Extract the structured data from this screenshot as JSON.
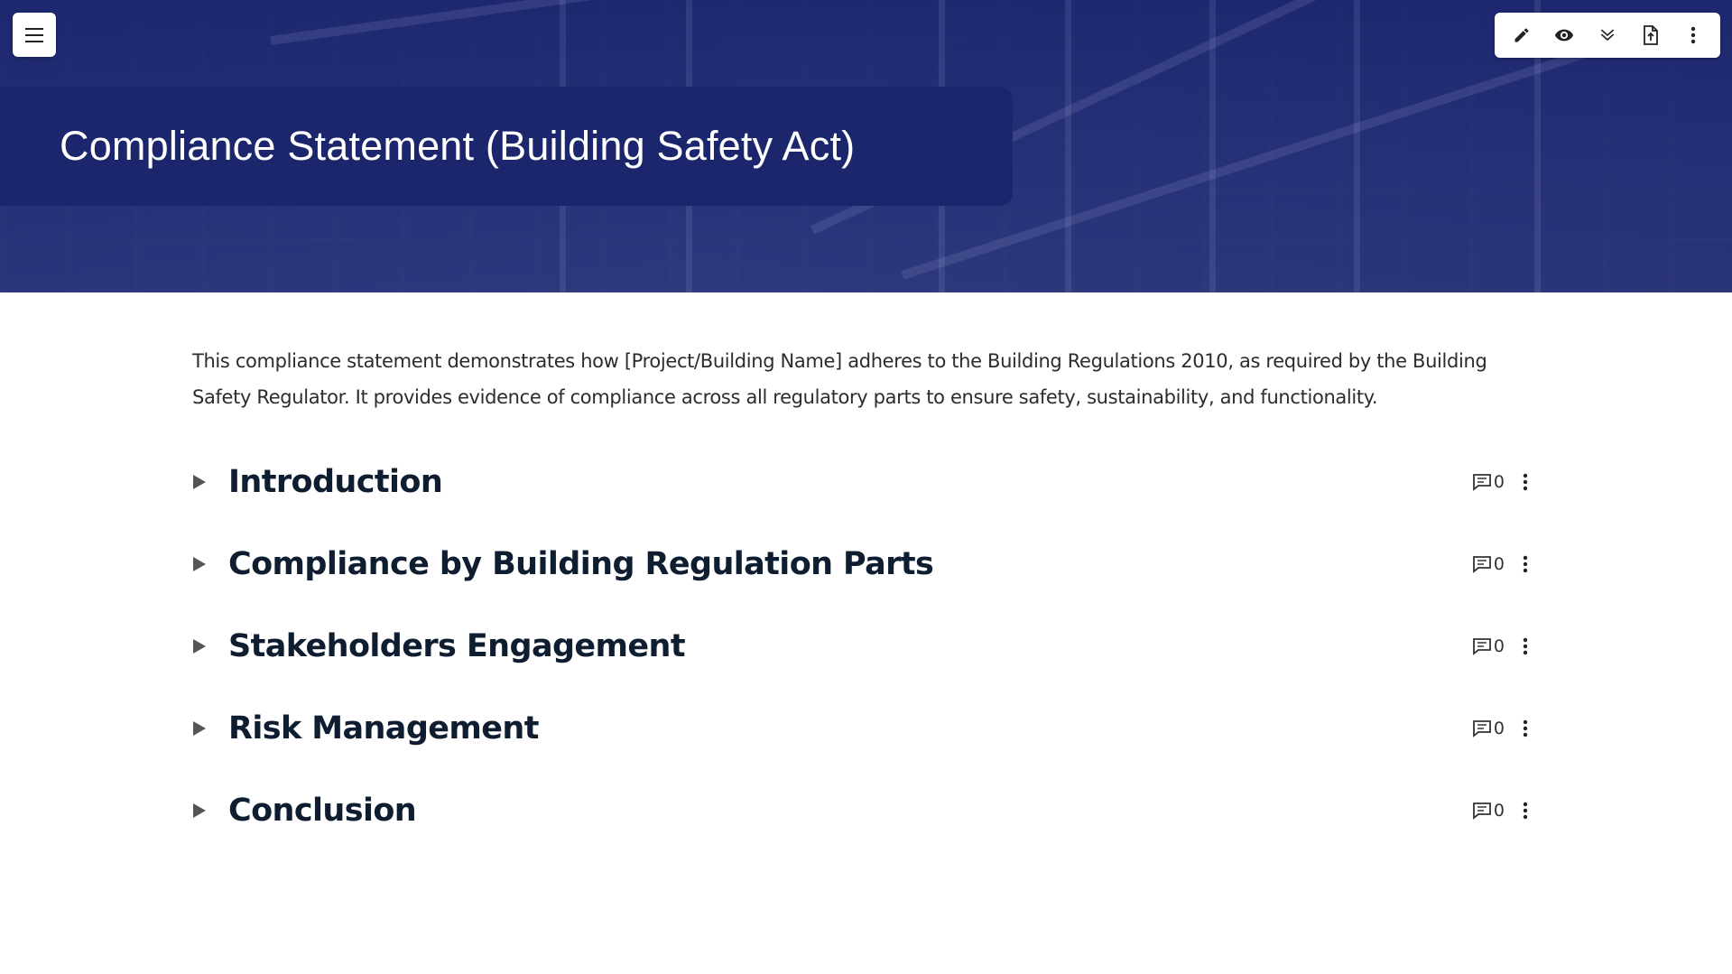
{
  "header": {
    "title": "Compliance Statement (Building Safety Act)"
  },
  "menu": {
    "icon": "hamburger-menu-icon"
  },
  "toolbar": {
    "buttons": [
      {
        "name": "edit",
        "icon": "pencil-icon"
      },
      {
        "name": "preview",
        "icon": "eye-icon"
      },
      {
        "name": "expand-all",
        "icon": "double-chevron-down-icon"
      },
      {
        "name": "export",
        "icon": "file-export-icon"
      },
      {
        "name": "more",
        "icon": "more-vertical-icon"
      }
    ]
  },
  "document": {
    "intro": "This compliance statement demonstrates how [Project/Building Name] adheres to the Building Regulations 2010, as required by the Building Safety Regulator. It provides evidence of compliance across all regulatory parts to ensure safety, sustainability, and functionality.",
    "sections": [
      {
        "title": "Introduction",
        "comments": "0"
      },
      {
        "title": "Compliance by Building Regulation Parts",
        "comments": "0"
      },
      {
        "title": "Stakeholders Engagement",
        "comments": "0"
      },
      {
        "title": "Risk Management",
        "comments": "0"
      },
      {
        "title": "Conclusion",
        "comments": "0"
      }
    ]
  },
  "colors": {
    "title_panel": "#1b266c",
    "heading_text": "#0f1d30",
    "hero_overlay": "#2a3574"
  }
}
